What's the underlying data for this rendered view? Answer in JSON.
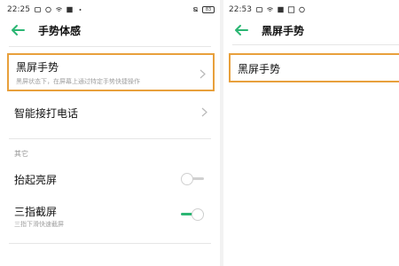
{
  "left": {
    "status": {
      "time": "22:25",
      "battery": "83"
    },
    "header": {
      "title": "手势体感"
    },
    "items": [
      {
        "title": "黑屏手势",
        "subtitle": "黑屏状态下，在屏幕上通过特定手势快捷操作"
      },
      {
        "title": "智能接打电话"
      }
    ],
    "section_label": "其它",
    "toggles": [
      {
        "title": "抬起亮屏",
        "state": "off"
      },
      {
        "title": "三指截屏",
        "subtitle": "三指下滑快速截屏",
        "state": "on"
      }
    ]
  },
  "right": {
    "status": {
      "time": "22:53"
    },
    "header": {
      "title": "黑屏手势"
    },
    "items": [
      {
        "title": "黑屏手势"
      }
    ]
  },
  "colors": {
    "accent": "#2bb673",
    "highlight": "#e8a03c"
  }
}
